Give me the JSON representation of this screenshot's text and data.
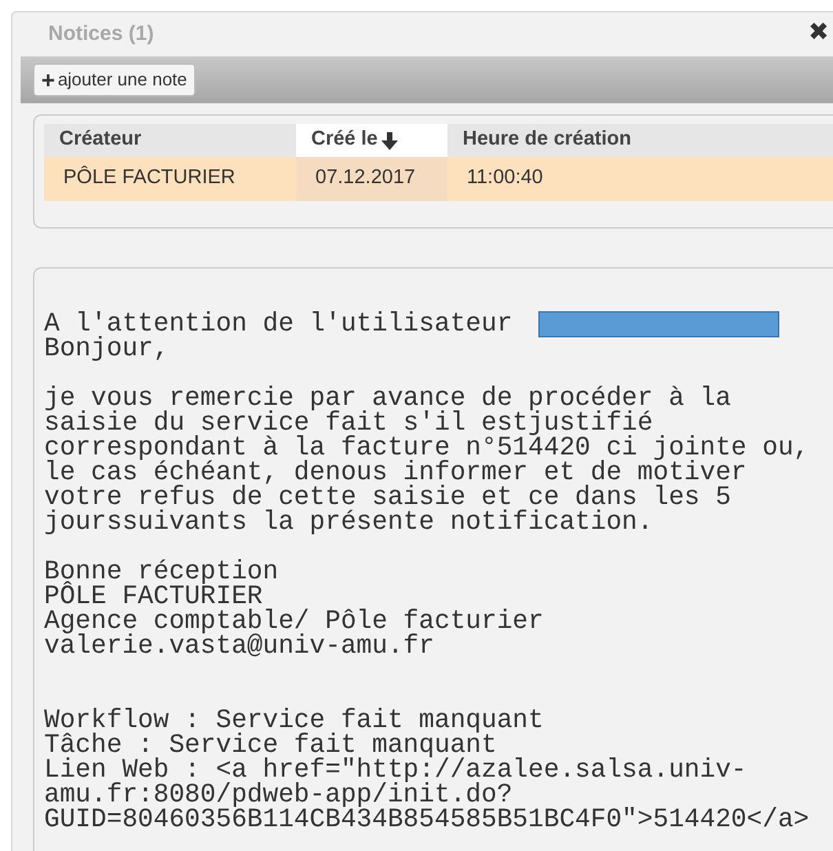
{
  "panel": {
    "title": "Notices (1)",
    "close_icon": "✖"
  },
  "toolbar": {
    "add_button": {
      "icon": "+",
      "label": "ajouter une note"
    }
  },
  "table": {
    "columns": [
      {
        "label": "Créateur",
        "sorted": false
      },
      {
        "label": "Créé le",
        "sorted": true
      },
      {
        "label": "Heure de création",
        "sorted": false
      }
    ],
    "rows": [
      {
        "selected": true,
        "cells": [
          "PÔLE FACTURIER",
          "07.12.2017",
          "11:00:40"
        ]
      }
    ]
  },
  "message": {
    "blocks": [
      {
        "kind": "greeting",
        "lines": [
          "A l'attention de l'utilisateur ",
          "Bonjour,"
        ]
      },
      {
        "kind": "paragraph",
        "lines": [
          "je vous remercie par avance de procéder à la",
          "saisie du service fait s'il estjustifié",
          "correspondant à la facture n°514420 ci jointe ou,",
          "le cas échéant, denous informer et de motiver",
          "votre refus de cette saisie et ce dans les 5",
          "jourssuivants la présente notification."
        ]
      },
      {
        "kind": "signature",
        "lines": [
          "Bonne réception",
          "PÔLE FACTURIER",
          "Agence comptable/ Pôle facturier",
          "valerie.vasta@univ-amu.fr"
        ]
      },
      {
        "kind": "paragraph",
        "lines": [
          "Workflow : Service fait manquant",
          "Tâche : Service fait manquant",
          "Lien Web : <a href=\"http://azalee.salsa.univ-",
          "amu.fr:8080/pdweb-app/init.do?",
          "GUID=80460356B114CB434B854585B51BC4F0\">514420</a>"
        ]
      }
    ]
  }
}
